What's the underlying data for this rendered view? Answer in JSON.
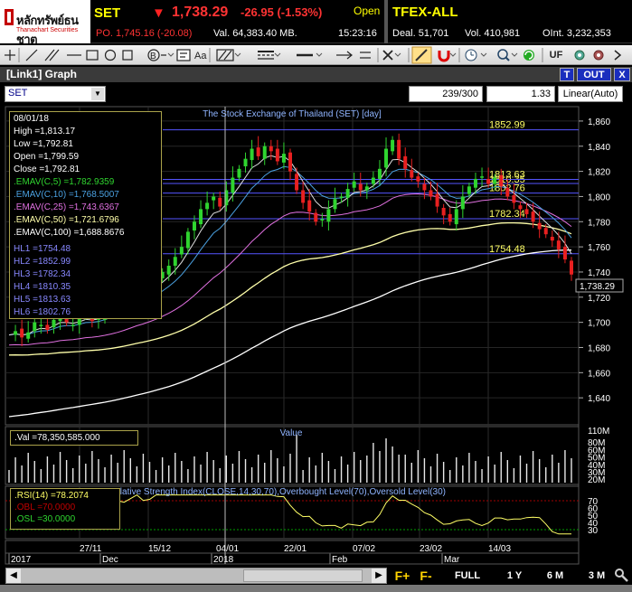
{
  "quote": {
    "logo_name": "หลักทรัพย์ธนชาต",
    "logo_sub": "Thanachart Securities",
    "symbol": "SET",
    "last": "1,738.29",
    "change": "-26.95 (-1.53%)",
    "state": "Open",
    "prev_close": "PO. 1,745.16 (-20.08)",
    "volume": "Val. 64,383.40 MB.",
    "time": "15:23:16",
    "tfex_name": "TFEX-ALL",
    "tfex_deal": "Deal. 51,701",
    "tfex_vol": "Vol. 410,981",
    "tfex_oint": "OInt. 3,232,353",
    "down_color": "#ff3333",
    "symbol_color": "#ffff00"
  },
  "toolbar": {
    "tools": [
      "crosshair-icon",
      "line-icon",
      "parallel-lines-icon",
      "ray-icon",
      "rectangle-icon",
      "circle-icon",
      "square-icon",
      "fibonacci-icon",
      "text-tool-icon",
      "font-icon",
      "pattern-icon",
      "line-style-icon",
      "line-width-icon",
      "arrows-icon",
      "delete-icon",
      "pencil-icon",
      "magnet-icon",
      "clock-icon",
      "zoom-icon",
      "refresh-icon"
    ],
    "uf_label": "UF"
  },
  "graph_panel": {
    "title": "[Link1] Graph",
    "symbol_value": "SET",
    "bar_count": "239/300",
    "scale_ratio": "1.33",
    "scale_mode": "Linear(Auto)",
    "btn_t": "T",
    "btn_out": "OUT",
    "btn_close": "X"
  },
  "info": {
    "date": "08/01/18",
    "high": "High  =1,813.17",
    "low": "Low   =1,792.81",
    "open": "Open  =1,799.59",
    "close": "Close =1,792.81",
    "emav5": ".EMAV(C,5)   =1,782.9359",
    "emav10": ".EMAV(C,10)  =1,768.5007",
    "emav25": ".EMAV(C,25)  =1,743.6367",
    "emav50": ".EMAV(C,50)  =1,721.6796",
    "emav100": ".EMAV(C,100)  =1,688.8676",
    "hl": [
      "HL1 =1754.48",
      "HL2 =1852.99",
      "HL3 =1782.34",
      "HL4 =1810.35",
      "HL5 =1813.63",
      "HL6 =1802.76"
    ],
    "val": ".Val   =78,350,585.000",
    "rsi": ".RSI(14)   =78.2074",
    "obl": ".OBL   =70.0000",
    "osl": ".OSL   =30.0000"
  },
  "colors": {
    "up": "#2fd42f",
    "down": "#e82020",
    "emav5": "#e0e0e0",
    "emav10": "#4aa0e0",
    "emav25": "#e070e0",
    "emav50": "#ffffaa",
    "emav100": "#ffffff",
    "hl_line": "#5555ff",
    "hl_label": "#ffff66",
    "info_label": "#00c0c0"
  },
  "chart_data": {
    "type": "line",
    "title": "The Stock Exchange of Thailand (SET) [day]",
    "ylim": [
      1620,
      1870
    ],
    "y_ticks": [
      1640,
      1660,
      1680,
      1700,
      1720,
      1740,
      1760,
      1780,
      1800,
      1820,
      1840,
      1860
    ],
    "last_price_label": "1,738.29",
    "horizontal_lines": [
      {
        "name": "HL1",
        "value": 1754.48,
        "label": "1754.48"
      },
      {
        "name": "HL2",
        "value": 1852.99,
        "label": "1852.99"
      },
      {
        "name": "HL3",
        "value": 1782.34,
        "label": "1782.34"
      },
      {
        "name": "HL4",
        "value": 1810.35,
        "label": "1810.35"
      },
      {
        "name": "HL5",
        "value": 1813.63,
        "label": "1813.63"
      },
      {
        "name": "HL6",
        "value": 1802.76,
        "label": "1802.76"
      }
    ],
    "x_tick_labels": [
      "27/11",
      "15/12",
      "04/01",
      "22/01",
      "07/02",
      "23/02",
      "14/03"
    ],
    "x_period_labels": [
      "2017",
      "Dec",
      "2018",
      "Feb",
      "Mar"
    ],
    "close_series": [
      1690,
      1693,
      1688,
      1692,
      1700,
      1698,
      1694,
      1702,
      1705,
      1700,
      1698,
      1703,
      1706,
      1701,
      1704,
      1708,
      1712,
      1716,
      1720,
      1725,
      1728,
      1724,
      1730,
      1734,
      1740,
      1745,
      1752,
      1760,
      1772,
      1780,
      1790,
      1795,
      1800,
      1792,
      1805,
      1815,
      1822,
      1830,
      1838,
      1832,
      1840,
      1836,
      1828,
      1834,
      1820,
      1805,
      1795,
      1788,
      1780,
      1782,
      1790,
      1798,
      1800,
      1806,
      1812,
      1805,
      1808,
      1815,
      1822,
      1838,
      1845,
      1830,
      1822,
      1815,
      1812,
      1805,
      1800,
      1792,
      1785,
      1780,
      1790,
      1800,
      1808,
      1814,
      1816,
      1810,
      1815,
      1808,
      1800,
      1795,
      1790,
      1786,
      1780,
      1774,
      1770,
      1765,
      1758,
      1750,
      1738
    ],
    "value_panel": {
      "title": "Value",
      "y_ticks": [
        "110M",
        "80M",
        "60M",
        "50M",
        "40M",
        "30M",
        "20M"
      ]
    },
    "rsi_panel": {
      "title": "Relative Strength Index(CLOSE,14,30,70),Overbought Level(70),Oversold Level(30)",
      "ylim": [
        20,
        80
      ],
      "y_ticks": [
        30,
        40,
        50,
        60,
        70
      ],
      "overbought": 70,
      "oversold": 30
    }
  },
  "bottom_nav": {
    "f_plus": "F+",
    "f_minus": "F-",
    "full": "FULL",
    "y1": "1 Y",
    "m6": "6 M",
    "m3": "3 M"
  }
}
